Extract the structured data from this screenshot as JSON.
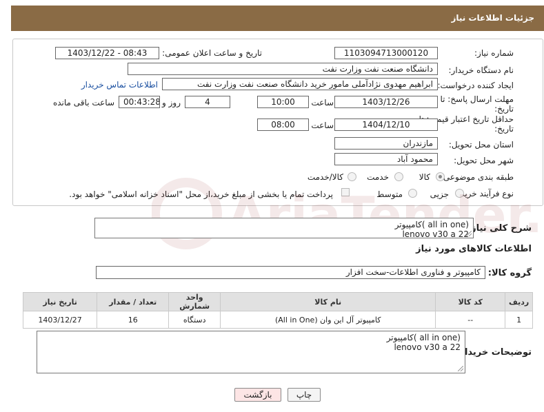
{
  "header": {
    "title": "جزئیات اطلاعات نیاز"
  },
  "form": {
    "need_number_label": "شماره نیاز:",
    "need_number": "1103094713000120",
    "announce_label": "تاریخ و ساعت اعلان عمومی:",
    "announce_value": "1403/12/22 - 08:43",
    "buyer_org_label": "نام دستگاه خریدار:",
    "buyer_org": "دانشگاه صنعت نفت وزارت نفت",
    "requester_label": "ایجاد کننده درخواست:",
    "requester": "ابراهیم مهدوی نژادآملی مامور خرید دانشگاه صنعت نفت وزارت نفت",
    "contact_link": "اطلاعات تماس خریدار",
    "deadline_label_1": "مهلت ارسال پاسخ: تا",
    "deadline_label_2": "تاریخ:",
    "deadline_date": "1403/12/26",
    "time_label": "ساعت",
    "deadline_time": "10:00",
    "days_value": "4",
    "days_label": "روز و",
    "remaining_time": "00:43:28",
    "remaining_label": "ساعت باقی مانده",
    "validity_label_1": "حداقل تاریخ اعتبار قیمت: تا",
    "validity_label_2": "تاریخ:",
    "validity_date": "1404/12/10",
    "validity_time_label": "ساعت",
    "validity_time": "08:00",
    "province_label": "استان محل تحویل:",
    "province": "مازندران",
    "city_label": "شهر محل تحویل:",
    "city": "محمود آباد",
    "category_label": "طبقه بندی موضوعی:",
    "category_options": [
      "کالا",
      "خدمت",
      "کالا/خدمت"
    ],
    "process_label": "نوع فرآیند خرید :",
    "process_options": [
      "جزیی",
      "متوسط"
    ],
    "payment_note": "پرداخت تمام یا بخشی از مبلغ خرید،از محل \"اسناد خزانه اسلامی\" خواهد بود."
  },
  "description": {
    "label": "شرح کلی نیاز:",
    "line1": "کامپیوتر( all in one)",
    "line2": "lenovo v30 a 22"
  },
  "goods": {
    "section_title": "اطلاعات کالاهای مورد نیاز",
    "group_label": "گروه کالا:",
    "group_value": "کامپیوتر و فناوری اطلاعات-سخت افزار",
    "columns": [
      "ردیف",
      "کد کالا",
      "نام کالا",
      "واحد شمارش",
      "تعداد / مقدار",
      "تاریخ نیاز"
    ],
    "rows": [
      {
        "row": "1",
        "code": "--",
        "name": "کامپیوتر آل این وان (All in One)",
        "unit": "دستگاه",
        "qty": "16",
        "date": "1403/12/27"
      }
    ]
  },
  "buyer_notes": {
    "label": "توضیحات خریدار:",
    "line1": "کامپیوتر( all in one)",
    "line2": "lenovo v30 a 22"
  },
  "buttons": {
    "print": "چاپ",
    "back": "بازگشت"
  },
  "watermark": {
    "text": "AriaTender.neT"
  },
  "colors": {
    "header_bg": "#8a6b45",
    "link": "#1a4fa0",
    "back_button_bg": "#fde5e5"
  }
}
